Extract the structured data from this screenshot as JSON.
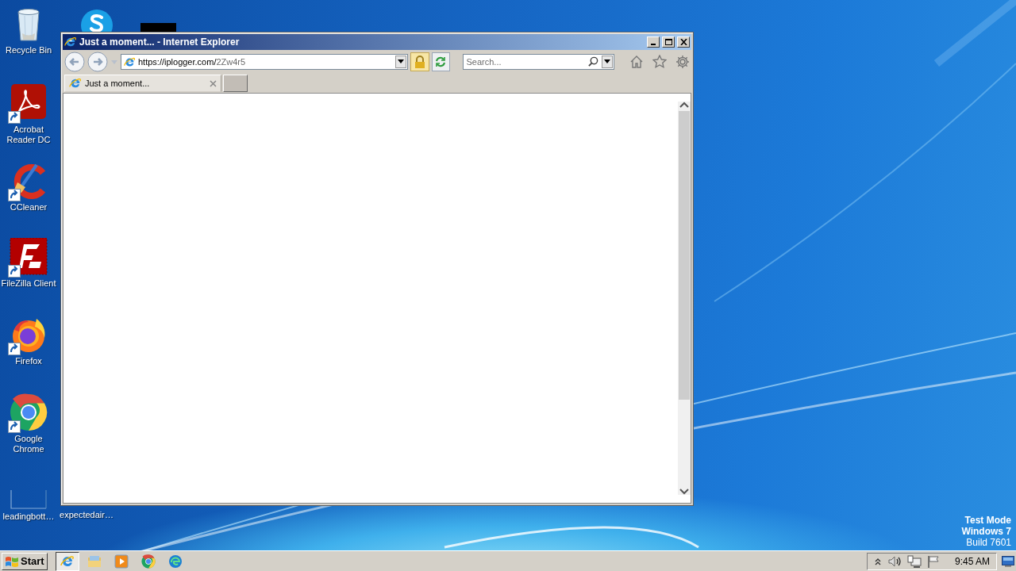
{
  "desktop": {
    "icons": [
      {
        "kind": "recycle",
        "label": "Recycle Bin"
      },
      {
        "kind": "skype"
      },
      {
        "kind": "blank"
      },
      {
        "kind": "acrobat",
        "label": "Acrobat Reader DC",
        "shortcut": true
      },
      {
        "kind": "ccleaner",
        "label": "CCleaner",
        "shortcut": true
      },
      {
        "kind": "filezilla",
        "label": "FileZilla Client",
        "shortcut": true
      },
      {
        "kind": "firefox",
        "label": "Firefox",
        "shortcut": true
      },
      {
        "kind": "chrome",
        "label": "Google Chrome",
        "shortcut": true
      },
      {
        "kind": "file",
        "label": "leadingbott…"
      },
      {
        "kind": "hidden",
        "label": "expectedair…"
      }
    ],
    "system_text": [
      "Test Mode",
      "Windows 7",
      "Build 7601"
    ]
  },
  "window": {
    "title": "Just a moment... - Internet Explorer",
    "address_host": "https://iplogger.com/",
    "address_path": "2Zw4r5",
    "search_placeholder": "Search...",
    "tabs": [
      {
        "label": "Just a moment...",
        "selected": true
      }
    ]
  },
  "taskbar": {
    "start": "Start",
    "apps": [
      {
        "kind": "ie",
        "selected": true
      },
      {
        "kind": "explorer",
        "selected": false
      },
      {
        "kind": "media",
        "selected": false
      },
      {
        "kind": "chrome",
        "selected": false
      },
      {
        "kind": "edge",
        "selected": false
      }
    ],
    "clock": "9:45 AM"
  }
}
